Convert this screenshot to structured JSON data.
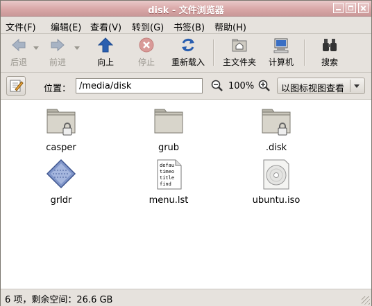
{
  "window": {
    "title": "disk - 文件浏览器"
  },
  "menu": [
    "文件(F)",
    "编辑(E)",
    "查看(V)",
    "转到(G)",
    "书签(B)",
    "帮助(H)"
  ],
  "toolbar": {
    "back": "后退",
    "forward": "前进",
    "up": "向上",
    "stop": "停止",
    "reload": "重新载入",
    "home": "主文件夹",
    "computer": "计算机",
    "search": "搜索"
  },
  "location": {
    "label": "位置：",
    "value": "/media/disk",
    "zoom": "100%",
    "view_mode": "以图标视图查看"
  },
  "files": [
    {
      "name": "casper",
      "icon": "folder-locked-icon"
    },
    {
      "name": "grub",
      "icon": "folder-icon"
    },
    {
      "name": ".disk",
      "icon": "folder-locked-icon"
    },
    {
      "name": "grldr",
      "icon": "binary-file-icon"
    },
    {
      "name": "menu.lst",
      "icon": "text-file-icon",
      "preview": [
        "defau",
        "timeo",
        "title",
        "find"
      ]
    },
    {
      "name": "ubuntu.iso",
      "icon": "disc-image-icon"
    }
  ],
  "status": "6 项，剩余空间：26.6 GB",
  "colors": {
    "titlebar": "#d9a7a7",
    "accent_blue": "#2a5fb0",
    "stop_red": "#c9302c"
  }
}
